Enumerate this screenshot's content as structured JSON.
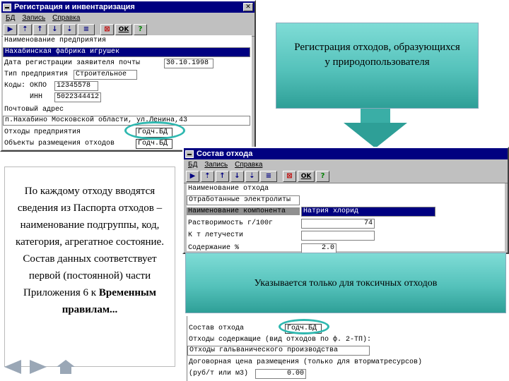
{
  "win1": {
    "title": "Регистрация и инвентаризация",
    "menu": [
      "БД",
      "Запись",
      "Справка"
    ],
    "rows": {
      "name_label": "Наименование предприятия",
      "name_value": "Нахабинская фабрика игрушек",
      "date_label": "Дата регистрации заявителя почты",
      "date_value": "30.10.1998",
      "type_label": "Тип предприятия",
      "type_value": "Строительное",
      "okpo_label": "Коды: ОКПО",
      "okpo_value": "12345578",
      "inn_label": "ИНН",
      "inn_value": "5022344412",
      "addr_label": "Почтовый адрес",
      "addr_value": "п.Нахабино Московской области, ул.Ленина,43",
      "waste_label": "Отходы предприятия",
      "waste_button": "Годч.БД",
      "objects_label": "Объекты размещения отходов",
      "objects_button": "Годч.БД"
    }
  },
  "callout_top": "Регистрация отходов, образующихся у природопользователя",
  "win2": {
    "title": "Состав отхода",
    "menu": [
      "БД",
      "Запись",
      "Справка"
    ],
    "rows": {
      "name_label": "Наименование отхода",
      "name_value": "Отработанные электролиты",
      "comp_label": "Наименование компонента",
      "comp_value": "Натрия хлорид",
      "sol_label": "Растворимость     г/100г",
      "sol_value": "74",
      "vol_label": "К т летучести",
      "vol_value": "",
      "cont_label": "Содержание     %",
      "cont_value": "2.0"
    }
  },
  "callout_toxic": "Указывается только для токсичных отходов",
  "lower": {
    "composition_label": "Состав отхода",
    "composition_button": "Годч.БД",
    "contains_label": "Отходы содержащие (вид отходов по ф. 2-ТП):",
    "contains_value": "Отходы гальванического производства",
    "price_label": "Договорная цена размещения (только для вторматресурсов)",
    "unit_label": "(руб/т или м3)",
    "unit_value": "0.00"
  },
  "left_text": {
    "normal": "По каждому отходу вводятся сведения из Паспорта отходов – наименование подгруппы, код, категория, агрегатное состояние. Состав данных соответствует первой (постоянной) части Приложения 6 к",
    "bold": "Временным правилам..."
  },
  "colors": {
    "title_bar": "#000080",
    "window": "#c0c0c0",
    "teal": "#55c2bb",
    "highlight": "#000080"
  },
  "icons": [
    "prev-record-icon",
    "up-icon",
    "up-alt-icon",
    "down-icon",
    "down-alt-icon",
    "list-icon",
    "delete-icon",
    "ok-icon",
    "help-icon"
  ]
}
